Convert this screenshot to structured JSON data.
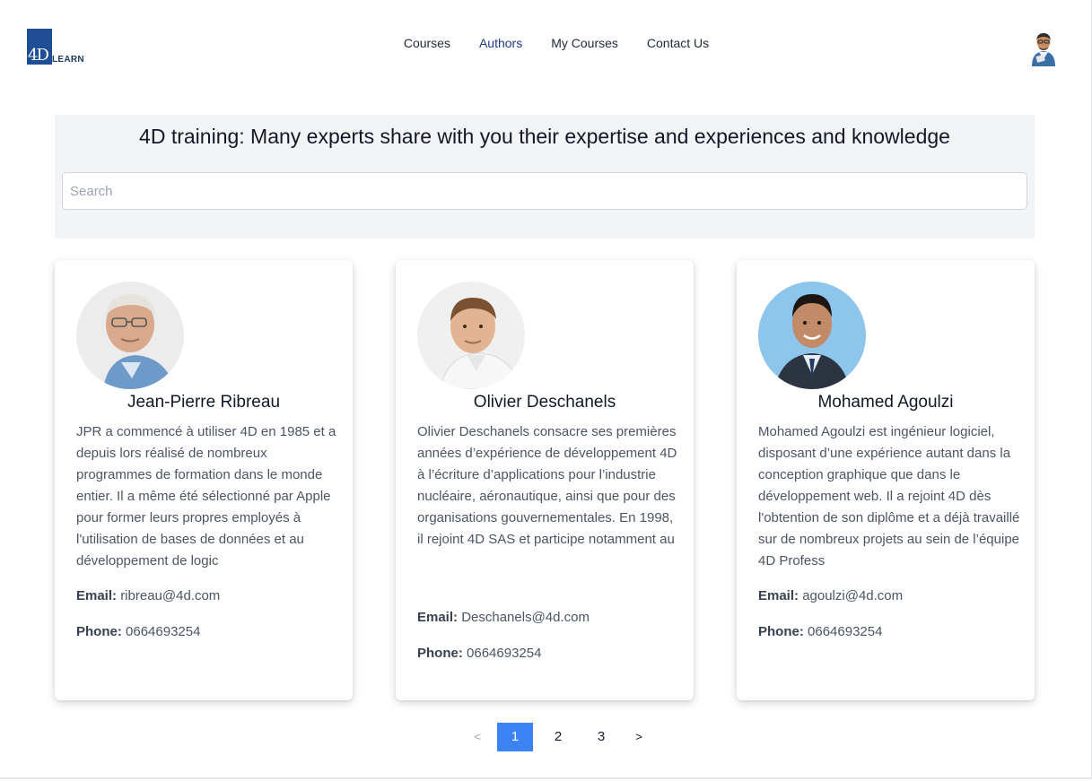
{
  "brand": {
    "logo_mark": "4D",
    "logo_word": "LEARN"
  },
  "nav": [
    {
      "label": "Courses",
      "active": false
    },
    {
      "label": "Authors",
      "active": true
    },
    {
      "label": "My Courses",
      "active": false
    },
    {
      "label": "Contact Us",
      "active": false
    }
  ],
  "hero": {
    "title": "4D training: Many experts share with you their expertise and experiences and knowledge",
    "search_placeholder": "Search"
  },
  "labels": {
    "email": "Email:",
    "phone": "Phone:"
  },
  "authors": [
    {
      "name": "Jean-Pierre Ribreau",
      "bio": "JPR a commencé à utiliser 4D en 1985 et a depuis lors réalisé de nombreux programmes de formation dans le monde entier. Il a même été sélectionné par Apple pour former leurs propres employés à l'utilisation de bases de données et au développement de logic",
      "email": "ribreau@4d.com",
      "phone": "0664693254",
      "photo_bg": "#e8e8e8"
    },
    {
      "name": "Olivier Deschanels",
      "bio": "Olivier Deschanels consacre ses premières années d’expérience de développement 4D à l’écriture d’applications pour l’industrie nucléaire, aéronautique, ainsi que pour des organisations gouvernementales. En 1998, il rejoint 4D SAS et participe notamment au",
      "email": "Deschanels@4d.com",
      "phone": "0664693254",
      "photo_bg": "#eeeeee"
    },
    {
      "name": "Mohamed Agoulzi",
      "bio": "Mohamed Agoulzi est ingénieur logiciel, disposant d’une expérience autant dans la conception graphique que dans le développement web. Il a rejoint 4D dès l'obtention de son diplôme et a déjà travaillé sur de nombreux projets au sein de l’équipe 4D Profess",
      "email": "agoulzi@4d.com",
      "phone": "0664693254",
      "photo_bg": "#8ec5ec"
    }
  ],
  "pagination": {
    "prev": "<",
    "pages": [
      "1",
      "2",
      "3"
    ],
    "current": "1",
    "next": ">"
  },
  "colors": {
    "accent": "#3b82f6",
    "nav_active": "#1e3a8a",
    "logo": "#1f4e96",
    "hero_bg": "#f3f4f6"
  },
  "icons": {
    "user_avatar": "user-avatar-icon"
  }
}
